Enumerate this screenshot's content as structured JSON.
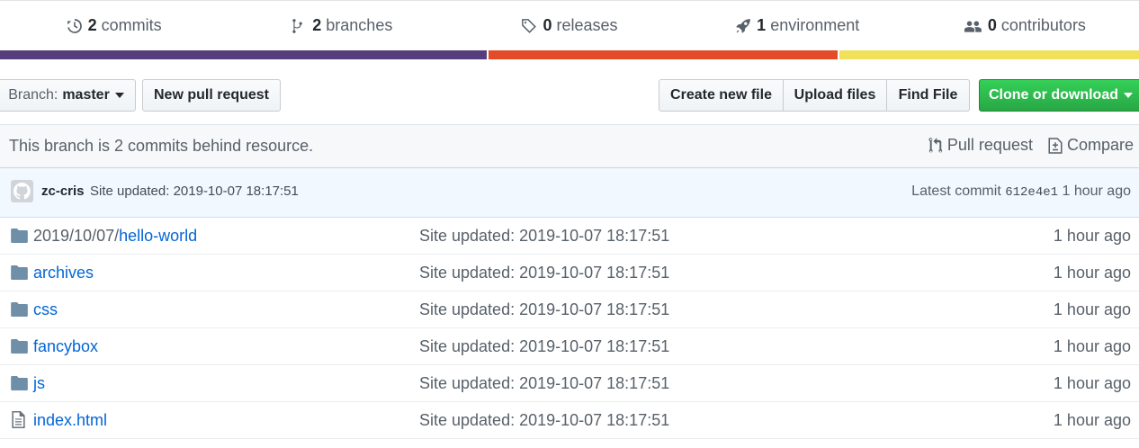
{
  "stats": [
    {
      "icon": "history-icon",
      "count": "2",
      "label": "commits"
    },
    {
      "icon": "branch-icon",
      "count": "2",
      "label": "branches"
    },
    {
      "icon": "tag-icon",
      "count": "0",
      "label": "releases"
    },
    {
      "icon": "rocket-icon",
      "count": "1",
      "label": "environment"
    },
    {
      "icon": "people-icon",
      "count": "0",
      "label": "contributors"
    }
  ],
  "language_bar": [
    {
      "color": "#563d7c",
      "share": 0.427
    },
    {
      "color": "#e34c26",
      "share": 0.308
    },
    {
      "color": "#f1e05a",
      "share": 0.265
    }
  ],
  "toolbar": {
    "branch_prefix": "Branch:",
    "branch_name": "master",
    "new_pr_label": "New pull request",
    "create_file_label": "Create new file",
    "upload_label": "Upload files",
    "find_label": "Find File",
    "clone_label": "Clone or download"
  },
  "behind": {
    "message": "This branch is 2 commits behind resource.",
    "pull_request_label": "Pull request",
    "compare_label": "Compare"
  },
  "latest_commit": {
    "author": "zc-cris",
    "message": "Site updated: 2019-10-07 18:17:51",
    "prefix": "Latest commit",
    "sha": "612e4e1",
    "age": "1 hour ago"
  },
  "files": [
    {
      "type": "directory",
      "dir_prefix": "2019/10/07/",
      "name": "hello-world",
      "message": "Site updated: 2019-10-07 18:17:51",
      "age": "1 hour ago"
    },
    {
      "type": "directory",
      "dir_prefix": "",
      "name": "archives",
      "message": "Site updated: 2019-10-07 18:17:51",
      "age": "1 hour ago"
    },
    {
      "type": "directory",
      "dir_prefix": "",
      "name": "css",
      "message": "Site updated: 2019-10-07 18:17:51",
      "age": "1 hour ago"
    },
    {
      "type": "directory",
      "dir_prefix": "",
      "name": "fancybox",
      "message": "Site updated: 2019-10-07 18:17:51",
      "age": "1 hour ago"
    },
    {
      "type": "directory",
      "dir_prefix": "",
      "name": "js",
      "message": "Site updated: 2019-10-07 18:17:51",
      "age": "1 hour ago"
    },
    {
      "type": "file",
      "dir_prefix": "",
      "name": "index.html",
      "message": "Site updated: 2019-10-07 18:17:51",
      "age": "1 hour ago"
    }
  ]
}
